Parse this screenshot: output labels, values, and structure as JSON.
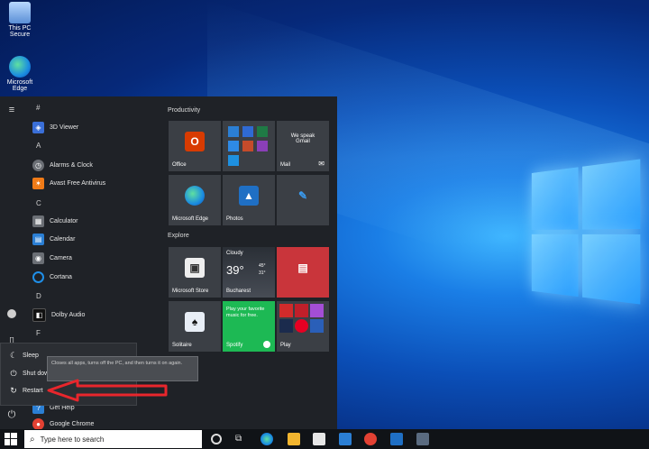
{
  "desktop": {
    "icons": [
      {
        "label": "This PC\nSecure"
      },
      {
        "label": "Microsoft\nEdge"
      }
    ]
  },
  "start_menu": {
    "app_list": [
      {
        "type": "letter",
        "text": "#"
      },
      {
        "type": "app",
        "label": "3D Viewer",
        "icon": "cube-icon",
        "color": "#3a6fd8"
      },
      {
        "type": "letter",
        "text": "A"
      },
      {
        "type": "app",
        "label": "Alarms & Clock",
        "icon": "clock-icon",
        "color": "#6b6f75"
      },
      {
        "type": "app",
        "label": "Avast Free Antivirus",
        "icon": "avast-icon",
        "color": "#f07b17"
      },
      {
        "type": "letter",
        "text": "C"
      },
      {
        "type": "app",
        "label": "Calculator",
        "icon": "calculator-icon",
        "color": "#6b6f75"
      },
      {
        "type": "app",
        "label": "Calendar",
        "icon": "calendar-icon",
        "color": "#2b7fd4"
      },
      {
        "type": "app",
        "label": "Camera",
        "icon": "camera-icon",
        "color": "#6b6f75"
      },
      {
        "type": "app",
        "label": "Cortana",
        "icon": "cortana-icon",
        "color": "#1f8fe8"
      },
      {
        "type": "letter",
        "text": "D"
      },
      {
        "type": "app",
        "label": "Dolby Audio",
        "icon": "dolby-icon",
        "color": "#111111"
      },
      {
        "type": "letter",
        "text": "F"
      }
    ],
    "bottom_apps": [
      {
        "label": "Get Help",
        "icon": "help-icon",
        "color": "#2b7fd4"
      },
      {
        "label": "Google Chrome",
        "icon": "chrome-icon",
        "color": "#e34133"
      }
    ],
    "power_menu": {
      "items": [
        {
          "label": "Sleep",
          "icon": "moon-icon"
        },
        {
          "label": "Shut down",
          "icon": "power-icon"
        },
        {
          "label": "Restart",
          "icon": "restart-icon"
        }
      ],
      "tooltip": "Closes all apps, turns off the PC, and then turns it on again."
    },
    "tile_groups": [
      {
        "label": "Productivity"
      },
      {
        "label": "Explore"
      }
    ],
    "tiles": {
      "office": {
        "label": "Office"
      },
      "mail": {
        "label": "Mail",
        "text": "We speak\nGmail"
      },
      "edge": {
        "label": "Microsoft Edge"
      },
      "photos": {
        "label": "Photos"
      },
      "store": {
        "label": "Microsoft Store"
      },
      "weather": {
        "label": "Bucharest",
        "condition": "Cloudy",
        "temp": "39°",
        "high": "45°",
        "low": "31°"
      },
      "news": {
        "label": ""
      },
      "solitaire": {
        "label": "Solitaire"
      },
      "spotify": {
        "label": "Spotify",
        "text": "Play your favorite music for free."
      },
      "play": {
        "label": "Play"
      }
    }
  },
  "taskbar": {
    "search_placeholder": "Type here to search"
  },
  "colors": {
    "annotation_arrow": "#e8262c",
    "spotify_green": "#1db954",
    "office_red": "#d83b01"
  }
}
